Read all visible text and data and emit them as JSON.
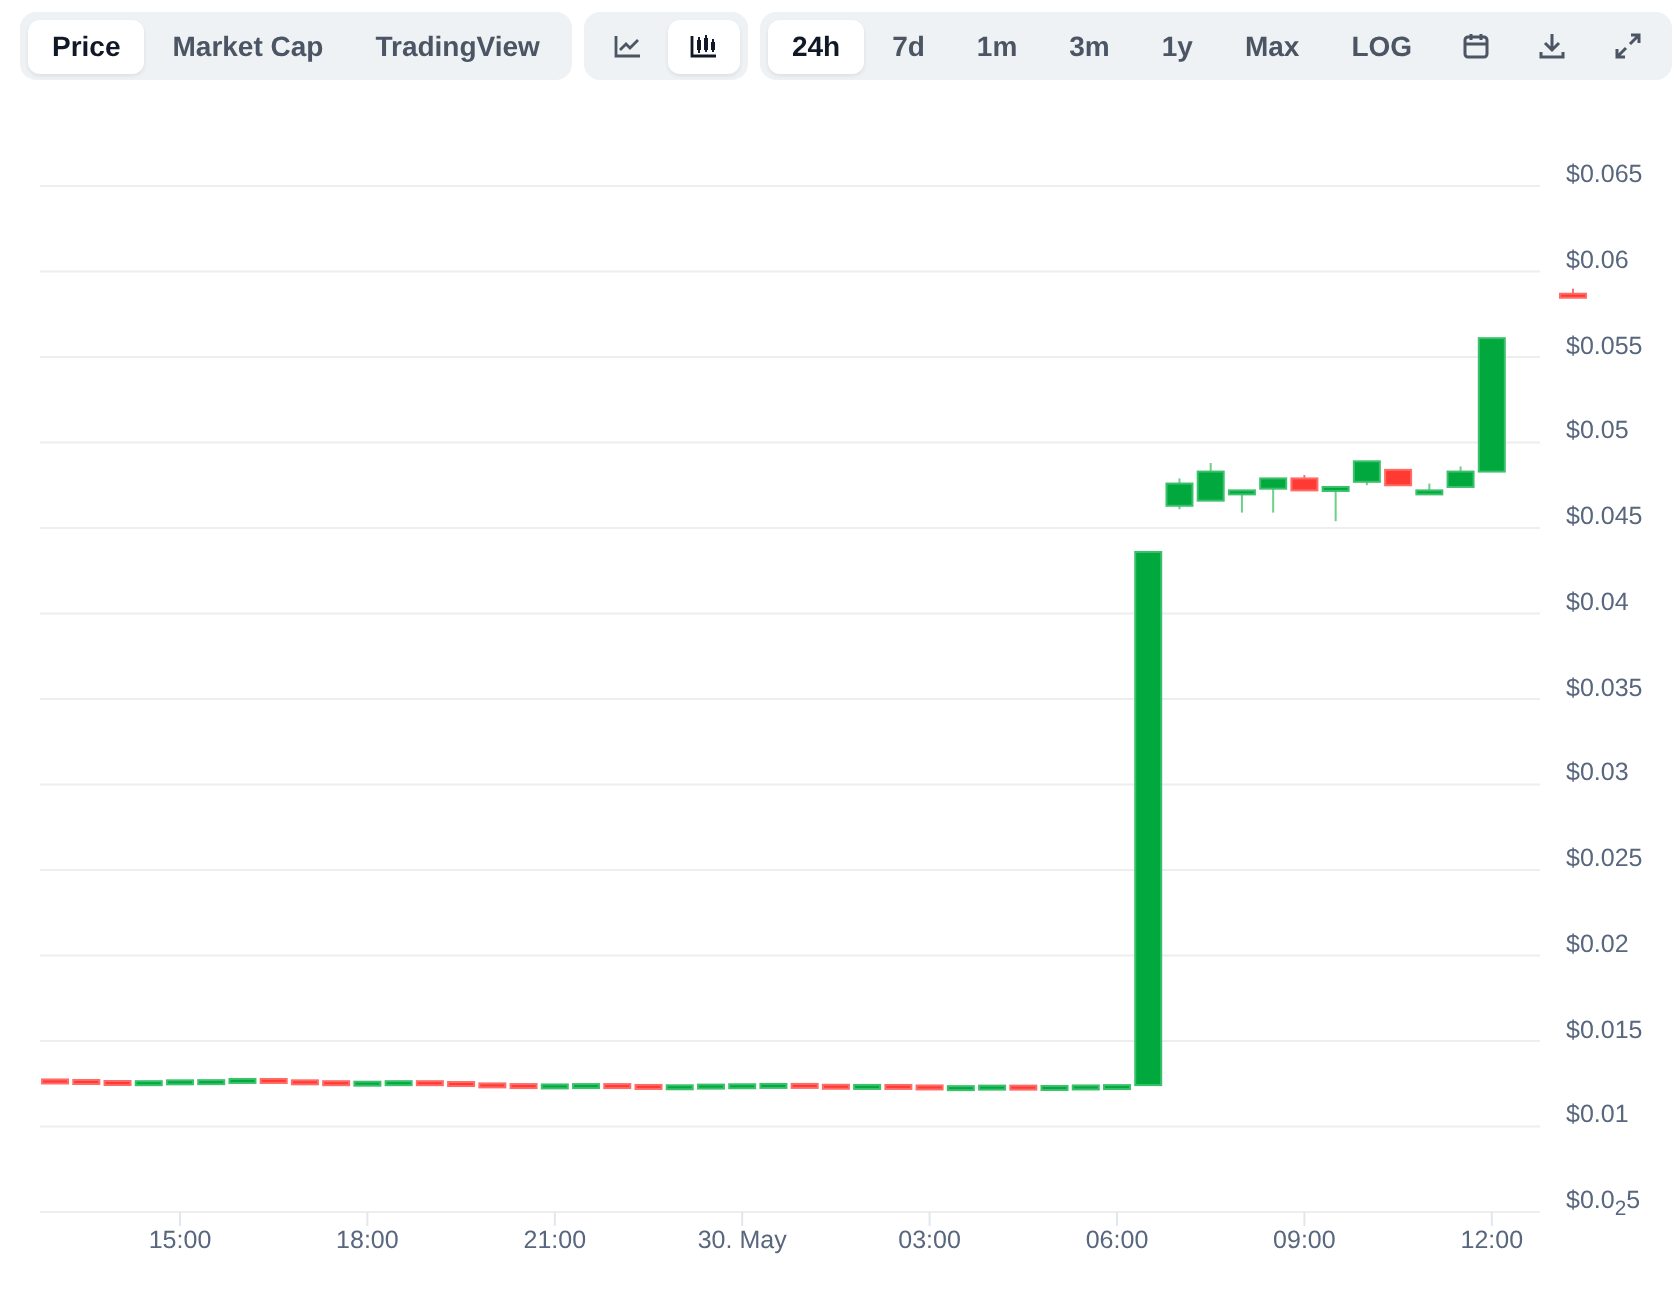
{
  "view_tabs": [
    {
      "label": "Price",
      "selected": true
    },
    {
      "label": "Market Cap",
      "selected": false
    },
    {
      "label": "TradingView",
      "selected": false
    }
  ],
  "chart_types": [
    {
      "kind": "line",
      "selected": false
    },
    {
      "kind": "candlestick",
      "selected": true
    }
  ],
  "ranges": [
    {
      "label": "24h",
      "selected": true
    },
    {
      "label": "7d",
      "selected": false
    },
    {
      "label": "1m",
      "selected": false
    },
    {
      "label": "3m",
      "selected": false
    },
    {
      "label": "1y",
      "selected": false
    },
    {
      "label": "Max",
      "selected": false
    }
  ],
  "log_button": {
    "label": "LOG",
    "on": false
  },
  "chart": {
    "y_axis_labels": [
      "$0.065",
      "$0.06",
      "$0.055",
      "$0.05",
      "$0.045",
      "$0.04",
      "$0.035",
      "$0.03",
      "$0.025",
      "$0.02",
      "$0.015",
      "$0.01",
      "$0.0$_{2}$5"
    ],
    "x_axis_labels": [
      "15:00",
      "18:00",
      "21:00",
      "30. May",
      "03:00",
      "06:00",
      "09:00",
      "12:00"
    ]
  }
}
